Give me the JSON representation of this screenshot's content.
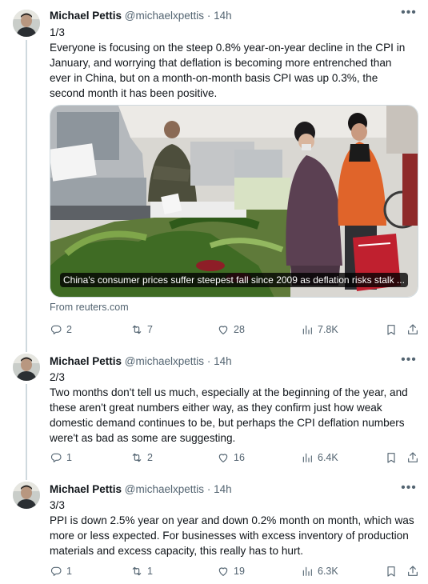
{
  "tweets": [
    {
      "name": "Michael Pettis",
      "handle": "@michaelxpettis",
      "separator": "·",
      "time": "14h",
      "lines": [
        "1/3",
        "Everyone is focusing on the steep 0.8% year-on-year decline in the CPI in",
        "January, and worrying that deflation is becoming more entrenched than",
        "ever in China, but on a month-on-month basis CPI was up 0.3%, the",
        "second month it has been positive."
      ],
      "card_caption": "China's consumer prices suffer steepest fall since 2009 as deflation risks stalk ...",
      "card_source": "From reuters.com",
      "replies": "2",
      "retweets": "7",
      "likes": "28",
      "views": "7.8K"
    },
    {
      "name": "Michael Pettis",
      "handle": "@michaelxpettis",
      "separator": "·",
      "time": "14h",
      "lines": [
        "2/3",
        "Two months don't tell us much, especially at the beginning of the year, and",
        "these aren't great numbers either way, as they confirm just how weak",
        "domestic demand continues to be, but perhaps the CPI deflation numbers",
        "were't as bad as some are suggesting."
      ],
      "replies": "1",
      "retweets": "2",
      "likes": "16",
      "views": "6.4K"
    },
    {
      "name": "Michael Pettis",
      "handle": "@michaelxpettis",
      "separator": "·",
      "time": "14h",
      "lines": [
        "3/3",
        "PPI is down 2.5% year on year and down 0.2% month on month, which was",
        "more or less expected. For businesses with excess inventory of production",
        "materials and excess capacity, this really has to hurt."
      ],
      "replies": "1",
      "retweets": "1",
      "likes": "19",
      "views": "6.3K"
    }
  ],
  "icons": {
    "more": "more-horizontal-icon",
    "reply": "reply-icon",
    "retweet": "retweet-icon",
    "like": "heart-icon",
    "views": "views-chart-icon",
    "bookmark": "bookmark-icon",
    "share": "share-icon"
  },
  "colors": {
    "text": "#0f1419",
    "secondary": "#536471",
    "thread_line": "#cfd9de"
  }
}
